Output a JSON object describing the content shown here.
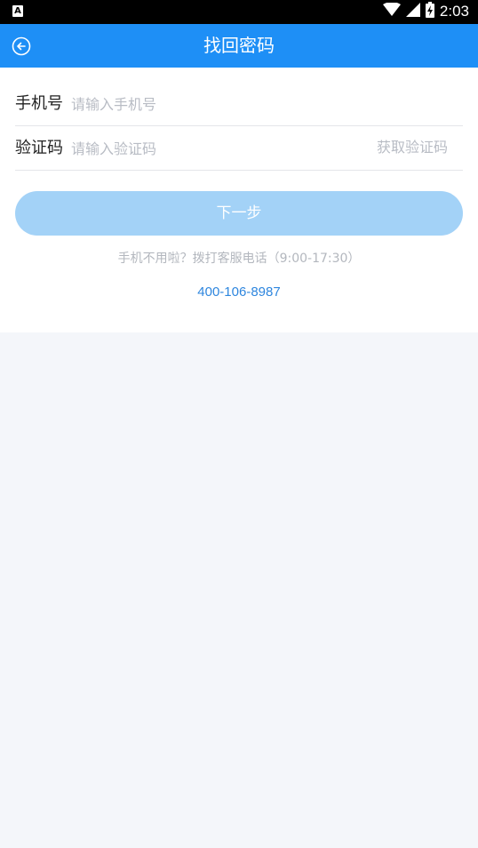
{
  "status_bar": {
    "app_badge": "A",
    "time": "2:03",
    "icons": [
      "wifi-icon",
      "cell-signal-icon",
      "battery-charging-icon"
    ]
  },
  "header": {
    "title": "找回密码",
    "back_icon": "back-circle-arrow-icon"
  },
  "form": {
    "phone": {
      "label": "手机号",
      "placeholder": "请输入手机号",
      "value": ""
    },
    "code": {
      "label": "验证码",
      "placeholder": "请输入验证码",
      "value": "",
      "get_code_label": "获取验证码"
    },
    "next_label": "下一步"
  },
  "help": {
    "text": "手机不用啦？拨打客服电话（9:00-17:30）",
    "phone": "400-106-8987"
  },
  "colors": {
    "header_bg": "#1e8ff6",
    "button_disabled_bg": "#a3d2f7",
    "link": "#2e86de",
    "page_bg": "#f4f6fa"
  }
}
